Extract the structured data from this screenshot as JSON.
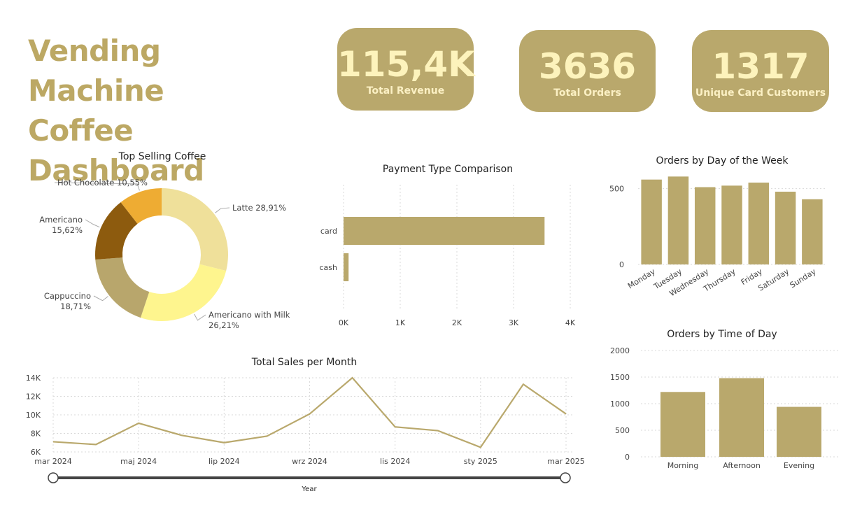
{
  "title_line1": "Vending Machine",
  "title_line2": "Coffee Dashboard",
  "kpis": [
    {
      "value": "115,4K",
      "label": "Total Revenue"
    },
    {
      "value": "3636",
      "label": "Total Orders"
    },
    {
      "value": "1317",
      "label": "Unique Card Customers"
    }
  ],
  "slider": {
    "label": "Year"
  },
  "colors": {
    "accent": "#b9a86c",
    "title": "#bca864",
    "kpi_text": "#fdf3bc"
  },
  "chart_data": [
    {
      "type": "pie",
      "title": "Top Selling Coffee",
      "donut": true,
      "slices": [
        {
          "label": "Latte 28,91%",
          "value": 28.91,
          "color": "#efe09a"
        },
        {
          "label": "Americano with Milk 26,21%",
          "value": 26.21,
          "color": "#fef58e"
        },
        {
          "label": "Cappuccino 18,71%",
          "value": 18.71,
          "color": "#b8a66c"
        },
        {
          "label": "Americano 15,62%",
          "value": 15.62,
          "color": "#8d5b0e"
        },
        {
          "label": "Hot Chocolate 10,55%",
          "value": 10.55,
          "color": "#eeac33"
        }
      ]
    },
    {
      "type": "bar",
      "orientation": "horizontal",
      "title": "Payment Type Comparison",
      "categories": [
        "card",
        "cash"
      ],
      "values": [
        3547,
        89
      ],
      "xlim": [
        0,
        4000
      ],
      "ticks": [
        "0K",
        "1K",
        "2K",
        "3K",
        "4K"
      ],
      "grid": true
    },
    {
      "type": "bar",
      "title": "Orders by Day of the Week",
      "categories": [
        "Monday",
        "Tuesday",
        "Wednesday",
        "Thursday",
        "Friday",
        "Saturday",
        "Sunday"
      ],
      "values": [
        560,
        580,
        510,
        520,
        540,
        480,
        430
      ],
      "ylim": [
        0,
        600
      ],
      "ticks": [
        "0",
        "500"
      ],
      "grid": true
    },
    {
      "type": "line",
      "title": "Total Sales per Month",
      "x": [
        "mar 2024",
        "kwi 2024",
        "maj 2024",
        "cze 2024",
        "lip 2024",
        "sie 2024",
        "wrz 2024",
        "paź 2024",
        "lis 2024",
        "gru 2024",
        "sty 2025",
        "lut 2025",
        "mar 2025"
      ],
      "xtick_labels": [
        "mar 2024",
        "maj 2024",
        "lip 2024",
        "wrz 2024",
        "lis 2024",
        "sty 2025",
        "mar 2025"
      ],
      "values": [
        7100,
        6800,
        9100,
        7800,
        7000,
        7700,
        10100,
        14000,
        8700,
        8300,
        6500,
        13300,
        10100
      ],
      "ylim": [
        6000,
        14000
      ],
      "ticks": [
        "6K",
        "8K",
        "10K",
        "12K",
        "14K"
      ],
      "grid": true
    },
    {
      "type": "bar",
      "title": "Orders by Time of Day",
      "categories": [
        "Morning",
        "Afternoon",
        "Evening"
      ],
      "values": [
        1220,
        1480,
        940
      ],
      "ylim": [
        0,
        2000
      ],
      "ticks": [
        "0",
        "500",
        "1000",
        "1500",
        "2000"
      ],
      "grid": true
    }
  ]
}
